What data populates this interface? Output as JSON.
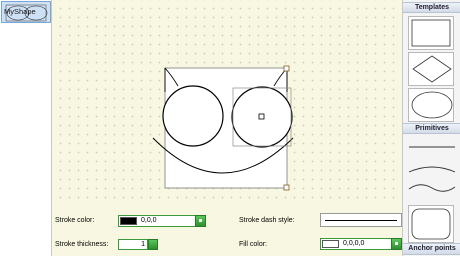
{
  "left_panel": {
    "thumbnail_label": "MyShape"
  },
  "properties": {
    "stroke_color_label": "Stroke color:",
    "stroke_color_value": "0,0,0",
    "stroke_color_hex": "#000000",
    "stroke_thickness_label": "Stroke thickness:",
    "stroke_thickness_value": "1",
    "stroke_dash_label": "Stroke dash style:",
    "fill_color_label": "Fill color:",
    "fill_color_value": "0,0,0,0",
    "fill_color_hex": "#ffffff"
  },
  "right_panel": {
    "templates_header": "Templates",
    "templates": [
      "rectangle-icon",
      "diamond-icon",
      "ellipse-icon"
    ],
    "primitives_header": "Primitives",
    "primitives": [
      "straight-line-icon",
      "curved-line-icon",
      "wave-line-icon",
      "rounded-rectangle-icon"
    ],
    "anchor_points_header": "Anchor points"
  }
}
